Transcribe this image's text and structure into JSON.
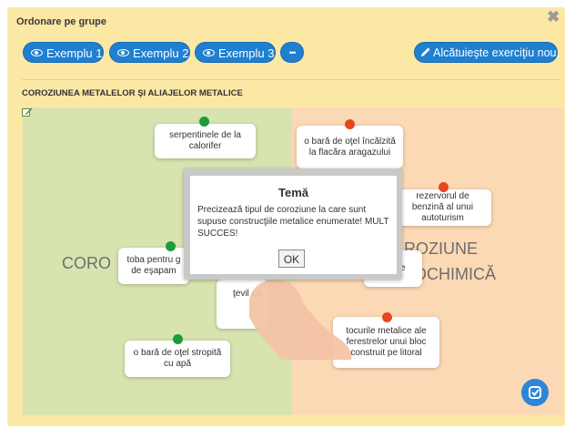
{
  "app": {
    "title": "Ordonare pe grupe",
    "close_symbol": "✖"
  },
  "toolbar": {
    "examples": [
      "Exemplu 1",
      "Exemplu 2",
      "Exemplu 3"
    ],
    "more_label": "•••",
    "create_label": "Alcătuieşte exerciţiu nou"
  },
  "exercise": {
    "subtitle": "COROZIUNEA METALELOR ŞI ALIAJELOR METALICE",
    "zones": {
      "left_label": "CORO",
      "right_label_1": "ROZIUNE",
      "right_label_2": "OCHIMICĂ"
    },
    "cards": {
      "c1": "serpentinele de la calorifer",
      "c2": "o bară de oţel încălzită la flacăra aragazului",
      "c3": "rezervorul de benzină al unui autoturism",
      "c4": "toba pentru g de eşapam",
      "c5": "e",
      "c6": "ţevil ca",
      "c7": "tocurile metalice ale ferestrelor unui bloc construit pe litoral",
      "c8": "o bară de oţel stropită cu apă"
    }
  },
  "dialog": {
    "title": "Temă",
    "message": "Precizează tipul de coroziune la care sunt supuse construcţiile metalice enumerate! MULT SUCCES!",
    "ok_label": "OK"
  },
  "colors": {
    "panel": "#fbe8a5",
    "button": "#1f7fd0",
    "zone_left": "#d7e4b0",
    "zone_right": "#fcd9b5",
    "dot_green": "#1f9b3a",
    "dot_red": "#e8461e"
  },
  "icons": [
    "close-icon",
    "eye-icon",
    "pencil-icon",
    "edit-icon",
    "check-icon"
  ]
}
